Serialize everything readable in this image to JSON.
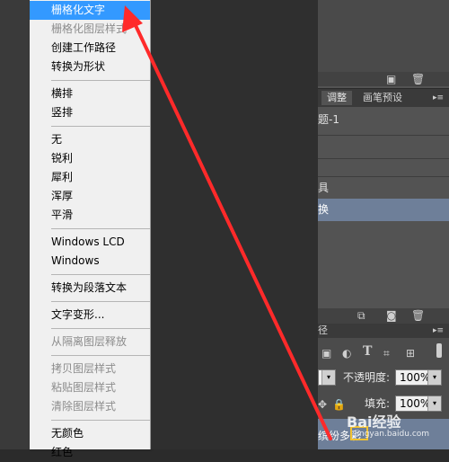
{
  "menu": {
    "items": [
      {
        "label": "栅格化文字",
        "state": "selected"
      },
      {
        "label": "栅格化图层样式",
        "state": "disabled"
      },
      {
        "label": "创建工作路径",
        "state": "normal"
      },
      {
        "label": "转换为形状",
        "state": "normal"
      },
      {
        "label": "横排",
        "state": "normal"
      },
      {
        "label": "竖排",
        "state": "normal"
      },
      {
        "label": "无",
        "state": "normal"
      },
      {
        "label": "锐利",
        "state": "normal"
      },
      {
        "label": "犀利",
        "state": "normal"
      },
      {
        "label": "浑厚",
        "state": "normal"
      },
      {
        "label": "平滑",
        "state": "normal"
      },
      {
        "label": "Windows LCD",
        "state": "normal"
      },
      {
        "label": "Windows",
        "state": "normal"
      },
      {
        "label": "转换为段落文本",
        "state": "normal"
      },
      {
        "label": "文字变形...",
        "state": "normal"
      },
      {
        "label": "从隔离图层释放",
        "state": "disabled"
      },
      {
        "label": "拷贝图层样式",
        "state": "disabled"
      },
      {
        "label": "粘贴图层样式",
        "state": "disabled"
      },
      {
        "label": "清除图层样式",
        "state": "disabled"
      },
      {
        "label": "无颜色",
        "state": "normal"
      },
      {
        "label": "红色",
        "state": "normal"
      }
    ]
  },
  "panel": {
    "tabs": [
      "调整",
      "画笔预设"
    ],
    "rows": [
      "题-1",
      "",
      "",
      "具",
      "换"
    ],
    "paths_tab_fragment": "径",
    "opacity_label": "不透明度:",
    "opacity_value": "100%",
    "fill_label": "填充:",
    "fill_value": "100%",
    "layer_text": "缤纷多彩"
  },
  "watermark": {
    "text": "Bai经验",
    "sub": "jingyan.baidu.com"
  },
  "colors": {
    "selected": "#3399ff",
    "arrow": "#ff2a2a",
    "panel": "#535353",
    "layer_highlight": "#6e7f99"
  }
}
